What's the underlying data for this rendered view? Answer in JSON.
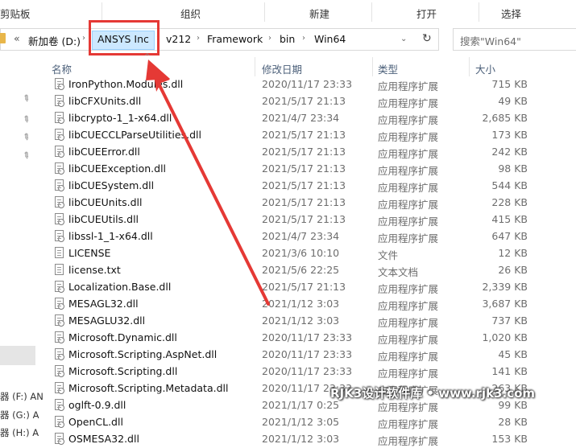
{
  "ribbon": {
    "groups": [
      "剪贴板",
      "组织",
      "新建",
      "打开",
      "选择"
    ]
  },
  "address": {
    "back_glyph": "«",
    "crumbs": [
      "新加卷 (D:)",
      "ANSYS Inc",
      "v212",
      "Framework",
      "bin",
      "Win64"
    ],
    "highlighted_crumb": "ANSYS Inc"
  },
  "search": {
    "placeholder": "搜索\"Win64\""
  },
  "columns": {
    "name": "名称",
    "date": "修改日期",
    "type": "类型",
    "size": "大小"
  },
  "nav": {
    "drives": [
      "器 (F:) AN",
      "器 (G:) A",
      "器 (H:) A"
    ]
  },
  "files": [
    {
      "name": "IronPython.Modules.dll",
      "date": "2020/11/17 23:33",
      "type": "应用程序扩展",
      "size": "715 KB",
      "icon": "dll-icon"
    },
    {
      "name": "libCFXUnits.dll",
      "date": "2021/5/17 21:13",
      "type": "应用程序扩展",
      "size": "49 KB",
      "icon": "dll-icon"
    },
    {
      "name": "libcrypto-1_1-x64.dll",
      "date": "2021/4/7 23:34",
      "type": "应用程序扩展",
      "size": "2,685 KB",
      "icon": "dll-icon"
    },
    {
      "name": "libCUECCLParseUtilities.dll",
      "date": "2021/5/17 21:13",
      "type": "应用程序扩展",
      "size": "173 KB",
      "icon": "dll-icon"
    },
    {
      "name": "libCUEError.dll",
      "date": "2021/5/17 21:13",
      "type": "应用程序扩展",
      "size": "242 KB",
      "icon": "dll-icon"
    },
    {
      "name": "libCUEException.dll",
      "date": "2021/5/17 21:13",
      "type": "应用程序扩展",
      "size": "98 KB",
      "icon": "dll-icon"
    },
    {
      "name": "libCUESystem.dll",
      "date": "2021/5/17 21:13",
      "type": "应用程序扩展",
      "size": "544 KB",
      "icon": "dll-icon"
    },
    {
      "name": "libCUEUnits.dll",
      "date": "2021/5/17 21:13",
      "type": "应用程序扩展",
      "size": "228 KB",
      "icon": "dll-icon"
    },
    {
      "name": "libCUEUtils.dll",
      "date": "2021/5/17 21:13",
      "type": "应用程序扩展",
      "size": "415 KB",
      "icon": "dll-icon"
    },
    {
      "name": "libssl-1_1-x64.dll",
      "date": "2021/4/7 23:34",
      "type": "应用程序扩展",
      "size": "647 KB",
      "icon": "dll-icon"
    },
    {
      "name": "LICENSE",
      "date": "2021/3/6 10:10",
      "type": "文件",
      "size": "12 KB",
      "icon": "file-icon"
    },
    {
      "name": "license.txt",
      "date": "2021/5/6 22:25",
      "type": "文本文档",
      "size": "26 KB",
      "icon": "text-file-icon"
    },
    {
      "name": "Localization.Base.dll",
      "date": "2021/5/17 21:13",
      "type": "应用程序扩展",
      "size": "2,339 KB",
      "icon": "dll-icon"
    },
    {
      "name": "MESAGL32.dll",
      "date": "2021/1/12 3:03",
      "type": "应用程序扩展",
      "size": "3,687 KB",
      "icon": "dll-icon"
    },
    {
      "name": "MESAGLU32.dll",
      "date": "2021/1/12 3:03",
      "type": "应用程序扩展",
      "size": "737 KB",
      "icon": "dll-icon"
    },
    {
      "name": "Microsoft.Dynamic.dll",
      "date": "2020/11/17 23:33",
      "type": "应用程序扩展",
      "size": "1,020 KB",
      "icon": "dll-icon"
    },
    {
      "name": "Microsoft.Scripting.AspNet.dll",
      "date": "2020/11/17 23:33",
      "type": "应用程序扩展",
      "size": "45 KB",
      "icon": "dll-icon"
    },
    {
      "name": "Microsoft.Scripting.dll",
      "date": "2020/11/17 23:33",
      "type": "应用程序扩展",
      "size": "141 KB",
      "icon": "dll-icon"
    },
    {
      "name": "Microsoft.Scripting.Metadata.dll",
      "date": "2020/11/17 23:33",
      "type": "应用程序扩展",
      "size": "263 KB",
      "icon": "dll-icon"
    },
    {
      "name": "oglft-0.9.dll",
      "date": "2021/1/17 0:25",
      "type": "应用程序扩展",
      "size": "99 KB",
      "icon": "dll-icon"
    },
    {
      "name": "OpenCL.dll",
      "date": "2021/1/12 3:05",
      "type": "应用程序扩展",
      "size": "28 KB",
      "icon": "dll-icon"
    },
    {
      "name": "OSMESA32.dll",
      "date": "2021/1/12 3:03",
      "type": "应用程序扩展",
      "size": "153 KB",
      "icon": "dll-icon"
    }
  ],
  "watermark": "RJK3设计软件库 • www.rjk3.com",
  "colors": {
    "highlight_red": "#e53935",
    "selection_blue": "#cce8ff"
  }
}
